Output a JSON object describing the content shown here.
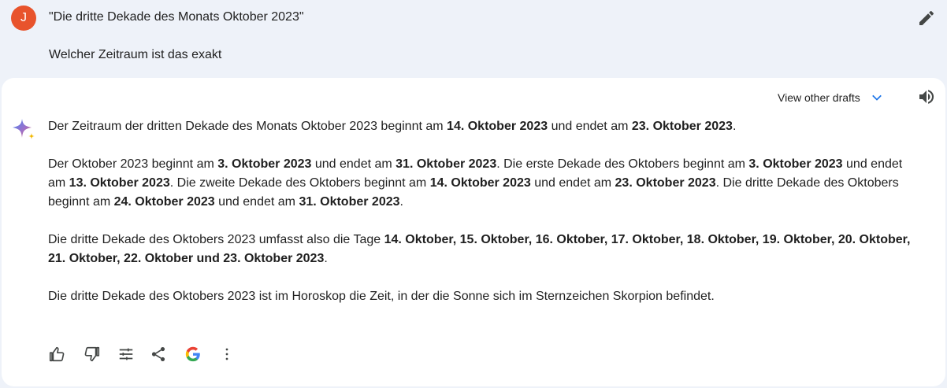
{
  "user": {
    "avatar_letter": "J",
    "avatar_color": "#e8532c",
    "prompt_line1": "\"Die dritte Dekade des Monats Oktober 2023\"",
    "prompt_line2": "Welcher Zeitraum ist das exakt",
    "edit_icon": "pencil-icon"
  },
  "response": {
    "drafts_label": "View other drafts",
    "accent_color": "#1a73e8",
    "icons": [
      "sparkle-icon",
      "speaker-icon",
      "chevron-down-icon"
    ],
    "p1": {
      "a": "Der Zeitraum der dritten Dekade des Monats Oktober 2023 beginnt am ",
      "b": "14. Oktober 2023",
      "c": " und endet am ",
      "d": "23. Oktober 2023",
      "e": "."
    },
    "p2": {
      "a": "Der Oktober 2023 beginnt am ",
      "b": "3. Oktober 2023",
      "c": " und endet am ",
      "d": "31. Oktober 2023",
      "e": ". Die erste Dekade des Oktobers beginnt am ",
      "f": "3. Oktober 2023",
      "g": " und endet am ",
      "h": "13. Oktober 2023",
      "i": ". Die zweite Dekade des Oktobers beginnt am ",
      "j": "14. Oktober 2023",
      "k": " und endet am ",
      "l": "23. Oktober 2023",
      "m": ". Die dritte Dekade des Oktobers beginnt am ",
      "n": "24. Oktober 2023",
      "o": " und endet am ",
      "p": "31. Oktober 2023",
      "q": "."
    },
    "p3": {
      "a": "Die dritte Dekade des Oktobers 2023 umfasst also die Tage ",
      "b": "14. Oktober, 15. Oktober, 16. Oktober, 17. Oktober, 18. Oktober, 19. Oktober, 20. Oktober, 21. Oktober, 22. Oktober und 23. Oktober 2023",
      "c": "."
    },
    "p4": "Die dritte Dekade des Oktobers 2023 ist im Horoskop die Zeit, in der die Sonne sich im Sternzeichen Skorpion befindet."
  },
  "actions": [
    "thumbs-up-icon",
    "thumbs-down-icon",
    "tune-icon",
    "share-icon",
    "google-icon",
    "more-vert-icon"
  ]
}
